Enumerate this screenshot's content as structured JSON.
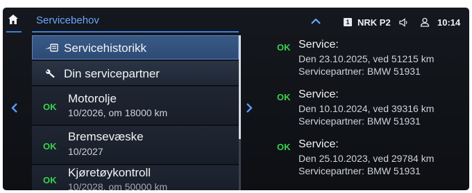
{
  "header": {
    "title": "Servicebehov",
    "radio_preset": "1",
    "radio_station": "NRK P2",
    "time": "10:14"
  },
  "colors": {
    "accent": "#3f7fe0",
    "title_blue": "#6aa6ff",
    "ok_green": "#39d34a",
    "selected_bg": "#2c4a74"
  },
  "menu": {
    "items": [
      {
        "label": "Servicehistorikk",
        "icon": "service-history-icon"
      },
      {
        "label": "Din servicepartner",
        "icon": "wrench-icon"
      }
    ]
  },
  "service_items": [
    {
      "status": "OK",
      "title": "Motorolje",
      "detail": "10/2026, om 18000 km"
    },
    {
      "status": "OK",
      "title": "Bremsevæske",
      "detail": "10/2027"
    },
    {
      "status": "OK",
      "title": "Kjøretøykontroll",
      "detail": "10/2028, om 50000 km"
    }
  ],
  "history": [
    {
      "status": "OK",
      "title": "Service:",
      "date_line": "Den 23.10.2025, ved 51215 km",
      "partner_line": "Servicepartner: BMW 51931"
    },
    {
      "status": "OK",
      "title": "Service:",
      "date_line": "Den 10.10.2024, ved 39316 km",
      "partner_line": "Servicepartner: BMW 51931"
    },
    {
      "status": "OK",
      "title": "Service:",
      "date_line": "Den 25.10.2023, ved 29784 km",
      "partner_line": "Servicepartner: BMW 51931"
    }
  ]
}
